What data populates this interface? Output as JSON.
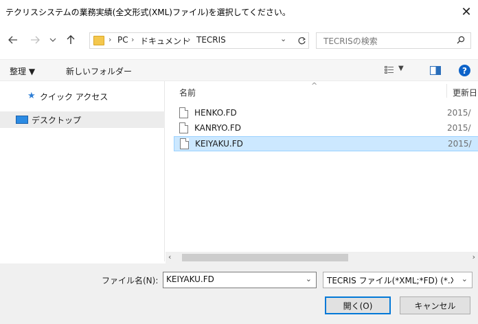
{
  "window": {
    "title": "テクリスシステムの業務実績(全文形式(XML)ファイル)を選択してください。",
    "close_glyph": "✕"
  },
  "nav": {
    "back_icon": "back-arrow-icon",
    "forward_icon": "forward-arrow-icon",
    "recent_icon": "chevron-down-icon",
    "up_icon": "up-arrow-icon",
    "breadcrumb": [
      "PC",
      "ドキュメント",
      "TECRIS"
    ],
    "refresh_icon": "refresh-icon",
    "search_placeholder": "TECRISの検索"
  },
  "toolbar": {
    "organize": "整理 ▼",
    "new_folder": "新しいフォルダー"
  },
  "sidebar": {
    "items": [
      {
        "label": "クイック アクセス",
        "icon": "star-icon"
      },
      {
        "label": "デスクトップ",
        "icon": "desktop-icon",
        "selected": true
      }
    ]
  },
  "filelist": {
    "columns": {
      "name": "名前",
      "date": "更新日"
    },
    "files": [
      {
        "name": "HENKO.FD",
        "date": "2015/",
        "selected": false
      },
      {
        "name": "KANRYO.FD",
        "date": "2015/",
        "selected": false
      },
      {
        "name": "KEIYAKU.FD",
        "date": "2015/",
        "selected": true
      }
    ]
  },
  "bottom": {
    "filename_label": "ファイル名(N):",
    "filename_value": "KEIYAKU.FD",
    "filetype_value": "TECRIS ファイル(*XML;*FD) (*.XML;*FD)",
    "open_label": "開く(O)",
    "cancel_label": "キャンセル"
  },
  "colors": {
    "selection_bg": "#cce8ff",
    "selection_border": "#99d1ff",
    "accent": "#0078d7"
  }
}
